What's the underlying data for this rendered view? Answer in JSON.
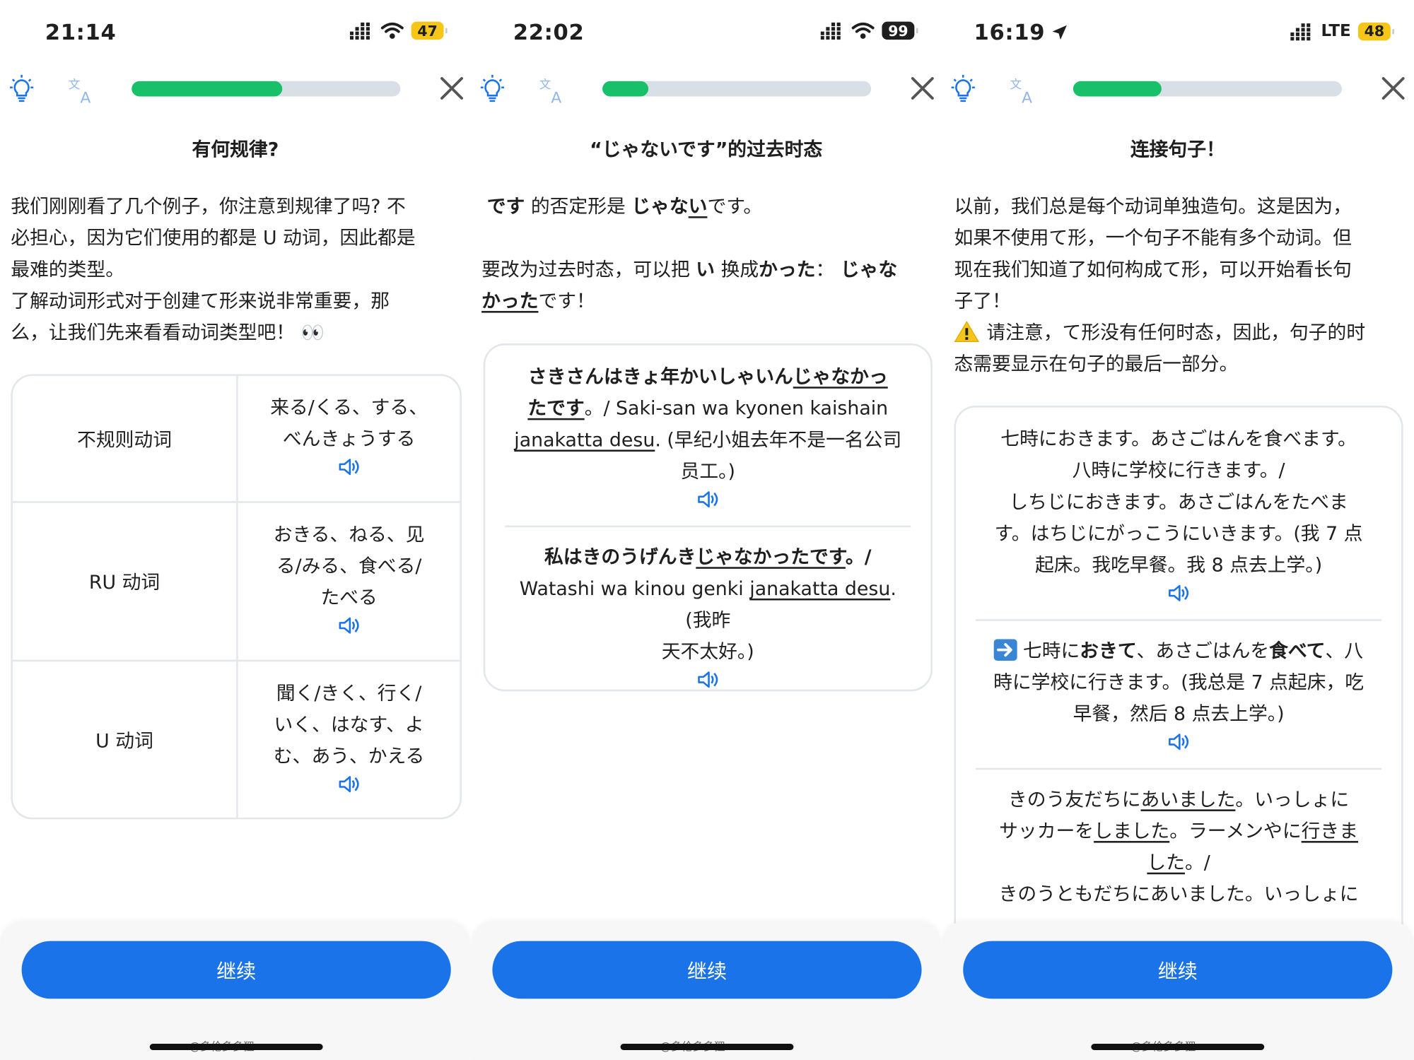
{
  "accent": "#1a73e8",
  "progress_color": "#18c06a",
  "panels": [
    {
      "status": {
        "time": "21:14",
        "battery": "47",
        "location_icon": false
      },
      "progress": 0.56,
      "title": "有何规律?",
      "para_lines": [
        "我们刚刚看了几个例子，你注意到规律了吗? 不",
        "必担心，因为它们使用的都是 U 动词，因此都是",
        "最难的类型。",
        "了解动词形式对于创建て形来说非常重要，那",
        "么，让我们先来看看动词类型吧！ 👀"
      ],
      "table": [
        {
          "type": "不规则动词",
          "lines": [
            "来る/くる、する、",
            "べんきょうする"
          ]
        },
        {
          "type": "RU 动词",
          "lines": [
            "おきる、ねる、见",
            "る/みる、食べる/",
            "たべる"
          ]
        },
        {
          "type": "U 动词",
          "lines": [
            "聞く/きく、行く/",
            "いく、はなす、よ",
            "む、あう、かえる"
          ]
        }
      ],
      "button": "继续",
      "watermark": "@多伦多多狸"
    },
    {
      "status": {
        "time": "22:02",
        "battery": "99",
        "location_icon": false
      },
      "progress": 0.17,
      "title": "“じゃないです”的过去时态",
      "line1": {
        "a": "です",
        "b": " 的否定形是 ",
        "c": "じゃな",
        "d": "い",
        "e": "です。"
      },
      "line2": {
        "a": "要改为过去时态，可以把 ",
        "b": "い",
        "c": " 换成",
        "d": "かった",
        "e": "：  ",
        "f": "じゃな"
      },
      "line3": {
        "a": "かった",
        "b": "です！"
      },
      "ex1": {
        "l1a": "さきさんはきょ年かいしゃいん",
        "l1b": "じゃなかっ",
        "l2a": "たです",
        "l2b": "。/ Saki-san wa kyonen kaishain",
        "l3a": "janakatta desu",
        "l3b": ". (早纪小姐去年不是一名公司",
        "l4": "员工。)"
      },
      "ex2": {
        "l1a": "私はきのうげんき",
        "l1b": "じゃなかったです",
        "l1c": "。/",
        "l2a": "Watashi wa kinou genki ",
        "l2b": "janakatta desu",
        "l2c": ". (我昨",
        "l3": "天不太好。)"
      },
      "button": "继续",
      "watermark": "@多伦多多狸"
    },
    {
      "status": {
        "time": "16:19",
        "battery": "48",
        "network": "LTE",
        "location_icon": true
      },
      "progress": 0.33,
      "title": "连接句子！",
      "para_lines": [
        "以前，我们总是每个动词单独造句。这是因为，",
        "如果不使用て形，一个句子不能有多个动词。但",
        "现在我们知道了如何构成て形，可以开始看长句",
        "子了！"
      ],
      "warn_lines": [
        "请注意，て形没有任何时态，因此，句子的时",
        "态需要显示在句子的最后一部分。"
      ],
      "ex1_lines": [
        "七時におきます。あさごはんを食べます。",
        "八時に学校に行きます。/",
        "しちじにおきます。あさごはんをたべま",
        "す。はちじにがっこうにいきます。(我 7 点",
        "起床。我吃早餐。我 8 点去上学。)"
      ],
      "ex2": {
        "a": "七時に",
        "b": "おきて",
        "c": "、あさごはんを",
        "d": "食べて",
        "e": "、八",
        "l2": "時に学校に行きます。(我总是 7 点起床，吃",
        "l3": "早餐，然后 8 点去上学。)"
      },
      "ex3": {
        "l1a": "きのう友だちに",
        "l1b": "あいました",
        "l1c": "。いっしょに",
        "l2a": "サッカーを",
        "l2b": "しました",
        "l2c": "。ラーメンやに",
        "l2d": "行きま",
        "l3a": "した",
        "l3b": "。/",
        "l4": "きのうともだちにあいました。いっしょに"
      },
      "button": "继续",
      "watermark": "@多伦多多狸"
    }
  ]
}
